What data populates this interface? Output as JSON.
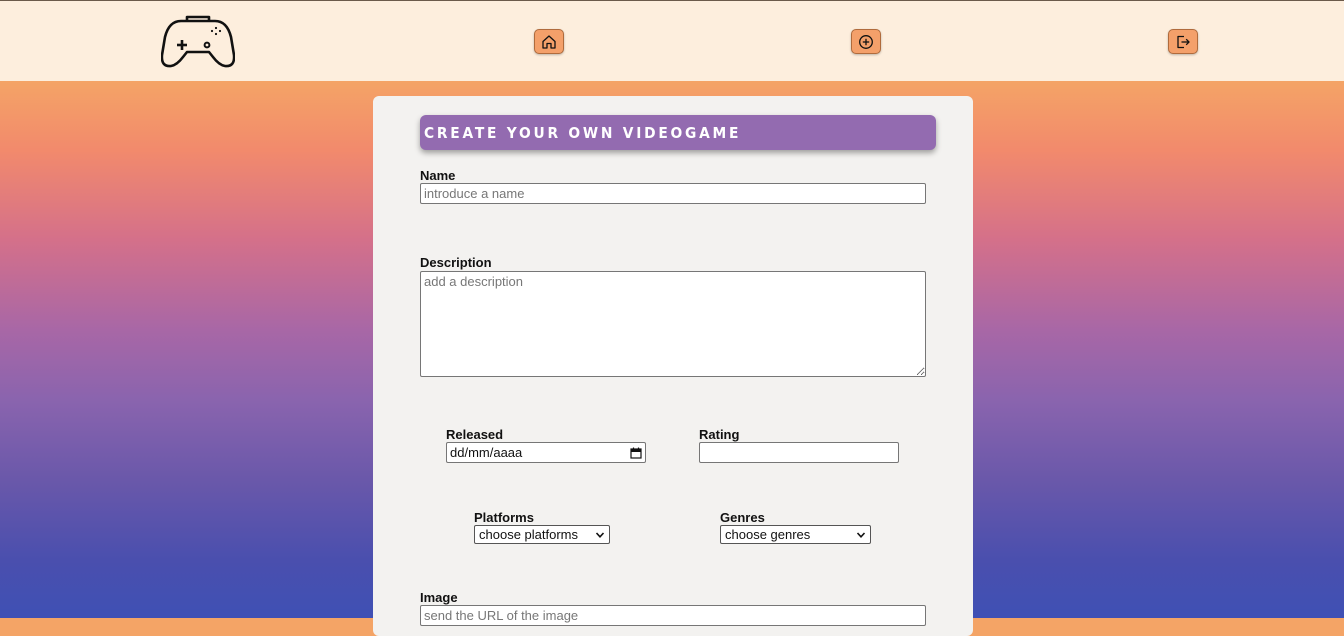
{
  "nav": {
    "logo_icon": "gamepad-icon",
    "buttons": [
      {
        "name": "home",
        "icon": "home-icon"
      },
      {
        "name": "create",
        "icon": "plus-circle-icon"
      },
      {
        "name": "logout",
        "icon": "logout-icon"
      }
    ],
    "button_color": "#f4a06a",
    "bar_color": "#fdeedd"
  },
  "form": {
    "title": "Create your own videogame",
    "name": {
      "label": "Name",
      "placeholder": "introduce a name",
      "value": ""
    },
    "description": {
      "label": "Description",
      "placeholder": "add a description",
      "value": ""
    },
    "released": {
      "label": "Released",
      "value": "dd/mm/aaaa"
    },
    "rating": {
      "label": "Rating",
      "value": ""
    },
    "platforms": {
      "label": "Platforms",
      "selected": "choose platforms"
    },
    "genres": {
      "label": "Genres",
      "selected": "choose genres"
    },
    "image": {
      "label": "Image",
      "placeholder": "send the URL of the image",
      "value": ""
    }
  },
  "colors": {
    "title_bg": "#936bb0",
    "card_bg": "#f3f2f0"
  }
}
